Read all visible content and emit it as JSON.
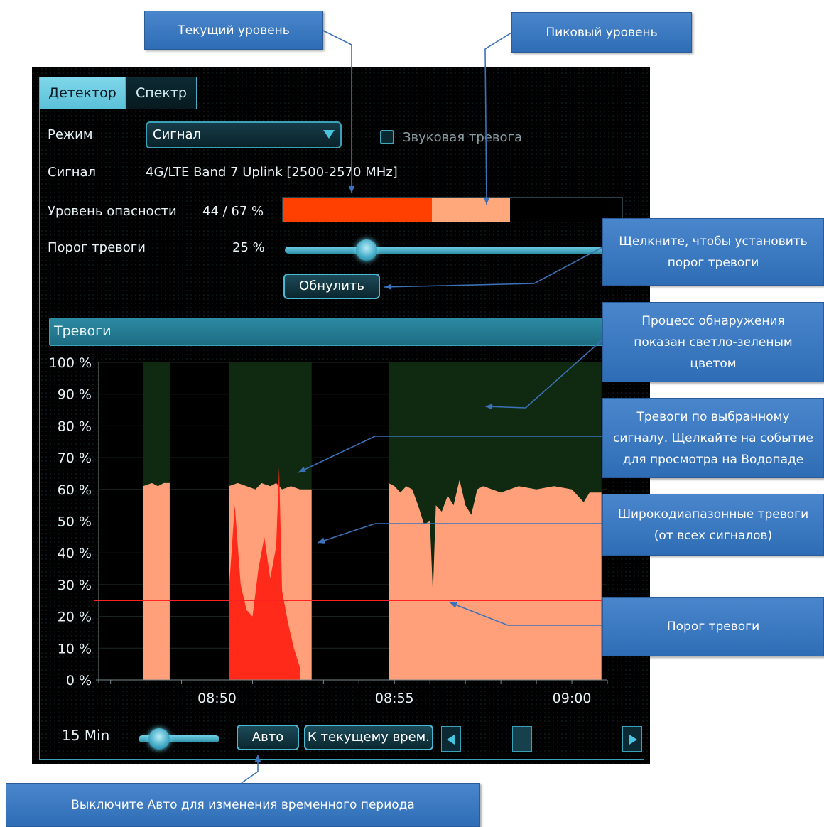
{
  "tabs": [
    {
      "label": "Детектор",
      "active": true
    },
    {
      "label": "Спектр",
      "active": false
    }
  ],
  "mode": {
    "label": "Режим",
    "value": "Сигнал"
  },
  "sound_alarm": {
    "label": "Звуковая тревога",
    "checked": false
  },
  "signal": {
    "label": "Сигнал",
    "value": "4G/LTE Band 7 Uplink [2500-2570 MHz]"
  },
  "danger": {
    "label": "Уровень опасности",
    "value_text": "44 / 67 %",
    "current_percent": 44,
    "peak_percent": 67,
    "current_color": "#ff4000",
    "peak_color": "#ffa87c"
  },
  "threshold": {
    "label": "Порог тревоги",
    "value_text": "25 %",
    "percent": 25
  },
  "reset_button": "Обнулить",
  "alarms_header": "Тревоги",
  "chart_data": {
    "type": "area",
    "y_ticks": [
      "100 %",
      "90 %",
      "80 %",
      "70 %",
      "60 %",
      "50 %",
      "40 %",
      "30 %",
      "20 %",
      "10 %",
      "0 %"
    ],
    "x_ticks": [
      "08:50",
      "08:55",
      "09:00"
    ],
    "ylim": [
      0,
      100
    ],
    "threshold": 25,
    "detection_color": "#0f2a10",
    "wideband_color": "#ffa07a",
    "signal_color": "#ff2a1a",
    "threshold_color": "#ff2020",
    "detection_periods": [
      [
        "08:47:55",
        "08:48:40"
      ],
      [
        "08:50:20",
        "08:52:40"
      ],
      [
        "08:54:50",
        "09:00:50"
      ]
    ],
    "wideband_series": [
      [
        "08:47:55",
        0
      ],
      [
        "08:47:55",
        61
      ],
      [
        "08:48:10",
        62
      ],
      [
        "08:48:20",
        61
      ],
      [
        "08:48:30",
        62
      ],
      [
        "08:48:40",
        62
      ],
      [
        "08:48:40",
        0
      ],
      [
        "08:50:20",
        0
      ],
      [
        "08:50:20",
        61
      ],
      [
        "08:50:35",
        62
      ],
      [
        "08:50:50",
        61
      ],
      [
        "08:51:05",
        60
      ],
      [
        "08:51:15",
        62
      ],
      [
        "08:51:30",
        61
      ],
      [
        "08:51:40",
        62
      ],
      [
        "08:51:50",
        60
      ],
      [
        "08:52:05",
        61
      ],
      [
        "08:52:20",
        60
      ],
      [
        "08:52:40",
        60
      ],
      [
        "08:52:40",
        0
      ],
      [
        "08:54:50",
        0
      ],
      [
        "08:54:50",
        62
      ],
      [
        "08:55:00",
        61
      ],
      [
        "08:55:10",
        59
      ],
      [
        "08:55:20",
        61
      ],
      [
        "08:55:30",
        60
      ],
      [
        "08:55:40",
        55
      ],
      [
        "08:55:50",
        49
      ],
      [
        "08:56:00",
        50
      ],
      [
        "08:56:05",
        27
      ],
      [
        "08:56:10",
        55
      ],
      [
        "08:56:20",
        53
      ],
      [
        "08:56:30",
        58
      ],
      [
        "08:56:40",
        55
      ],
      [
        "08:56:50",
        63
      ],
      [
        "08:57:00",
        55
      ],
      [
        "08:57:10",
        52
      ],
      [
        "08:57:20",
        60
      ],
      [
        "08:57:30",
        61
      ],
      [
        "08:57:45",
        60
      ],
      [
        "08:58:00",
        59
      ],
      [
        "08:58:15",
        60
      ],
      [
        "08:58:30",
        61
      ],
      [
        "08:59:00",
        60
      ],
      [
        "08:59:30",
        61
      ],
      [
        "09:00:00",
        60
      ],
      [
        "09:00:20",
        56
      ],
      [
        "09:00:30",
        59
      ],
      [
        "09:00:50",
        59
      ],
      [
        "09:00:50",
        0
      ]
    ],
    "signal_series": [
      [
        "08:50:20",
        0
      ],
      [
        "08:50:20",
        28
      ],
      [
        "08:50:30",
        55
      ],
      [
        "08:50:40",
        30
      ],
      [
        "08:50:50",
        22
      ],
      [
        "08:51:00",
        20
      ],
      [
        "08:51:10",
        35
      ],
      [
        "08:51:20",
        45
      ],
      [
        "08:51:30",
        32
      ],
      [
        "08:51:40",
        42
      ],
      [
        "08:51:45",
        67
      ],
      [
        "08:51:50",
        28
      ],
      [
        "08:52:00",
        18
      ],
      [
        "08:52:10",
        10
      ],
      [
        "08:52:20",
        4
      ],
      [
        "08:52:20",
        0
      ]
    ]
  },
  "bottom": {
    "time_window": "15 Min",
    "auto_button": "Авто",
    "now_button": "К текущему врем.",
    "time_window_fraction": 0.25
  },
  "callouts": {
    "current_level": "Текущий уровень",
    "peak_level": "Пиковый уровень",
    "set_threshold": "Щелкните, чтобы установить\nпорог тревоги",
    "detection": "Процесс обнаружения\nпоказан светло-зеленым\nцветом",
    "signal_alarms": "Тревоги по выбранному\nсигналу. Щелкайте на событие\nдля просмотра на Водопаде",
    "wideband_alarms": "Широкодиапазонные тревоги\n(от всех сигналов)",
    "threshold": "Порог тревоги",
    "auto": "Выключите Авто для изменения временного периода"
  }
}
